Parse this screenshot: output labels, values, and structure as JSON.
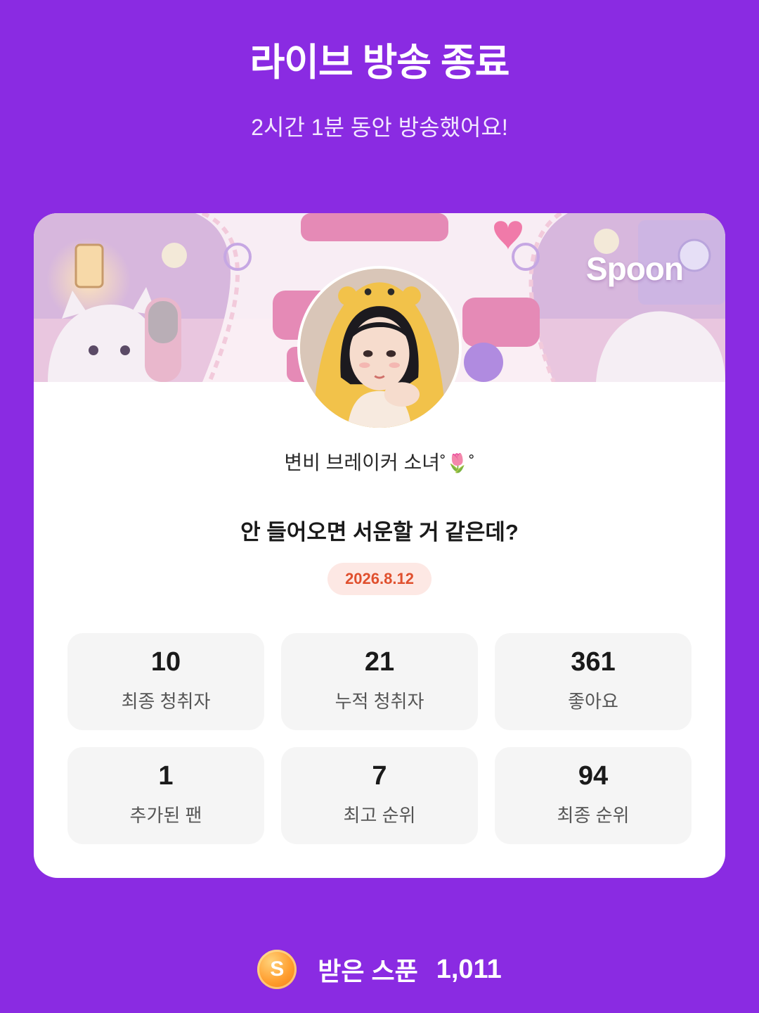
{
  "header": {
    "title": "라이브 방송 종료",
    "subtitle": "2시간 1분 동안 방송했어요!"
  },
  "card": {
    "brand": "Spoon",
    "nickname": "변비 브레이커 소녀",
    "nickname_deco": "˚🌷˚",
    "headline": "안 들어오면 서운할 거 같은데?",
    "date": "2026.8.12"
  },
  "stats": [
    {
      "value": "10",
      "label": "최종 청취자"
    },
    {
      "value": "21",
      "label": "누적 청취자"
    },
    {
      "value": "361",
      "label": "좋아요"
    },
    {
      "value": "1",
      "label": "추가된 팬"
    },
    {
      "value": "7",
      "label": "최고 순위"
    },
    {
      "value": "94",
      "label": "최종 순위"
    }
  ],
  "footer": {
    "coin_glyph": "S",
    "label": "받은 스푼",
    "value": "1,011"
  },
  "colors": {
    "background": "#8a2be2",
    "date_text": "#e0502e",
    "date_bg": "#fde8e4",
    "coin": "#ff9d2e"
  }
}
